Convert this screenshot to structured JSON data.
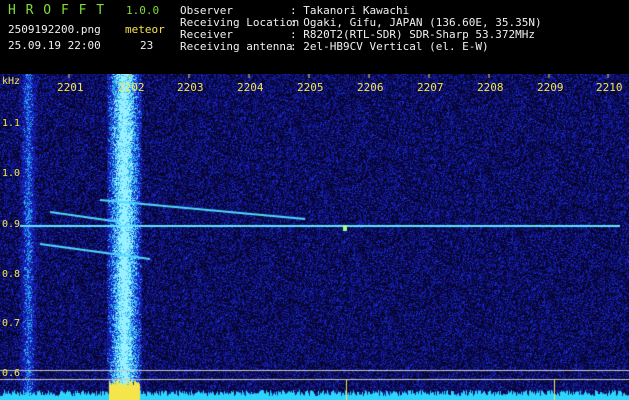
{
  "header": {
    "title": "H R O F F T",
    "version": "1.0.0",
    "filename": "2509192200.png",
    "datetime": "25.09.19 22:00",
    "meteor_label": "meteor",
    "meteor_count": "23"
  },
  "info": {
    "observer_label": "Observer",
    "observer_value": ": Takanori Kawachi",
    "location_label": "Receiving Location",
    "location_value": ": Ogaki, Gifu, JAPAN (136.60E, 35.35N)",
    "receiver_label": "Receiver",
    "receiver_value": ": R820T2(RTL-SDR) SDR-Sharp 53.372MHz",
    "antenna_label": "Receiving antenna",
    "antenna_value": ": 2el-HB9CV Vertical (el. E-W)"
  },
  "axes": {
    "y_unit": "kHz",
    "x_ticks": [
      "2201",
      "2202",
      "2203",
      "2204",
      "2205",
      "2206",
      "2207",
      "2208",
      "2209",
      "2210"
    ],
    "y_ticks": [
      "1.1",
      "1.0",
      "0.9",
      "0.8",
      "0.7",
      "0.6"
    ]
  },
  "colors": {
    "background": "#000000",
    "noise": "#1a1acc",
    "trace": "#4fe0ff",
    "accent": "#f4e64a",
    "title_green": "#7fdc3a"
  }
}
